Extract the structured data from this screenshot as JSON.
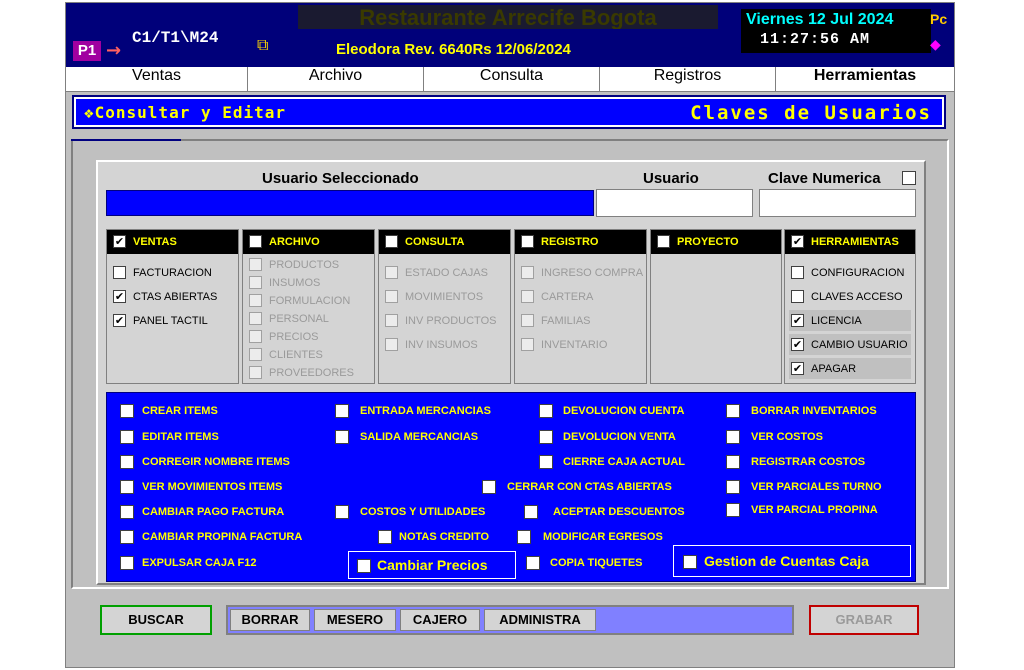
{
  "titlebar": {
    "pos_badge": "P1",
    "terminal": "C1/T1\\M24",
    "business_name": "Restaurante Arrecife Bogota",
    "revision": "Eleodora Rev. 6640Rs 12/06/2024",
    "date": "Viernes 12 Jul 2024",
    "time": "11:27:56 AM",
    "corner_stub": "Pc"
  },
  "menu": {
    "items": [
      "Ventas",
      "Archivo",
      "Consulta",
      "Registros",
      "Herramientas"
    ],
    "active": "Herramientas"
  },
  "header": {
    "left": "❖Consultar y Editar",
    "right": "Claves de Usuarios"
  },
  "user_section": {
    "selected_label": "Usuario Seleccionado",
    "user_label": "Usuario",
    "numeric_key_label": "Clave Numerica",
    "numeric_key_checked": false,
    "user_value": "",
    "key_value": ""
  },
  "modules": [
    {
      "title": "VENTAS",
      "checked": true,
      "enabled": true,
      "options": [
        {
          "label": "FACTURACION",
          "checked": false
        },
        {
          "label": "CTAS ABIERTAS",
          "checked": true
        },
        {
          "label": "PANEL TACTIL",
          "checked": true
        }
      ]
    },
    {
      "title": "ARCHIVO",
      "checked": false,
      "enabled": false,
      "options": [
        {
          "label": "PRODUCTOS",
          "checked": false
        },
        {
          "label": "INSUMOS",
          "checked": false
        },
        {
          "label": "FORMULACION",
          "checked": false
        },
        {
          "label": "PERSONAL",
          "checked": false
        },
        {
          "label": "PRECIOS",
          "checked": false
        },
        {
          "label": "CLIENTES",
          "checked": false
        },
        {
          "label": "PROVEEDORES",
          "checked": false
        }
      ]
    },
    {
      "title": "CONSULTA",
      "checked": false,
      "enabled": false,
      "options": [
        {
          "label": "ESTADO CAJAS",
          "checked": false
        },
        {
          "label": "MOVIMIENTOS",
          "checked": false
        },
        {
          "label": "INV PRODUCTOS",
          "checked": false
        },
        {
          "label": "INV INSUMOS",
          "checked": false
        }
      ]
    },
    {
      "title": "REGISTRO",
      "checked": false,
      "enabled": false,
      "options": [
        {
          "label": "INGRESO COMPRA",
          "checked": false
        },
        {
          "label": "CARTERA",
          "checked": false
        },
        {
          "label": "FAMILIAS",
          "checked": false
        },
        {
          "label": "INVENTARIO",
          "checked": false
        }
      ]
    },
    {
      "title": "PROYECTO",
      "checked": false,
      "enabled": false,
      "options": []
    },
    {
      "title": "HERRAMIENTAS",
      "checked": true,
      "enabled": true,
      "options": [
        {
          "label": "CONFIGURACION",
          "checked": false
        },
        {
          "label": "CLAVES ACCESO",
          "checked": false
        },
        {
          "label": "LICENCIA",
          "checked": true
        },
        {
          "label": "CAMBIO USUARIO",
          "checked": true
        },
        {
          "label": "APAGAR",
          "checked": true
        }
      ]
    }
  ],
  "permissions": [
    {
      "label": "CREAR ITEMS"
    },
    {
      "label": "EDITAR ITEMS"
    },
    {
      "label": "CORREGIR NOMBRE ITEMS"
    },
    {
      "label": "VER MOVIMIENTOS ITEMS"
    },
    {
      "label": "CAMBIAR PAGO FACTURA"
    },
    {
      "label": "CAMBIAR PROPINA FACTURA"
    },
    {
      "label": "EXPULSAR CAJA F12"
    },
    {
      "label": "ENTRADA MERCANCIAS"
    },
    {
      "label": "SALIDA MERCANCIAS"
    },
    {
      "label": "COSTOS Y UTILIDADES"
    },
    {
      "label": "NOTAS CREDITO"
    },
    {
      "label": "DEVOLUCION CUENTA"
    },
    {
      "label": "DEVOLUCION VENTA"
    },
    {
      "label": "CIERRE CAJA ACTUAL"
    },
    {
      "label": "CERRAR CON CTAS ABIERTAS"
    },
    {
      "label": "ACEPTAR DESCUENTOS"
    },
    {
      "label": "MODIFICAR EGRESOS"
    },
    {
      "label": "COPIA TIQUETES"
    },
    {
      "label": "BORRAR INVENTARIOS"
    },
    {
      "label": "VER COSTOS"
    },
    {
      "label": "REGISTRAR COSTOS"
    },
    {
      "label": "VER PARCIALES TURNO"
    },
    {
      "label": "VER PARCIAL PROPINA"
    },
    {
      "label": "Cambiar Precios"
    },
    {
      "label": "Gestion de Cuentas Caja"
    }
  ],
  "bottom": {
    "search": "BUSCAR",
    "roles": [
      "BORRAR",
      "MESERO",
      "CAJERO",
      "ADMINISTRA"
    ],
    "save": "GRABAR"
  },
  "colors": {
    "titlebar": "#00007a",
    "panel_blue": "#0000ff",
    "label_yellow": "#ffff00",
    "window_gray": "#c0c0c0"
  }
}
